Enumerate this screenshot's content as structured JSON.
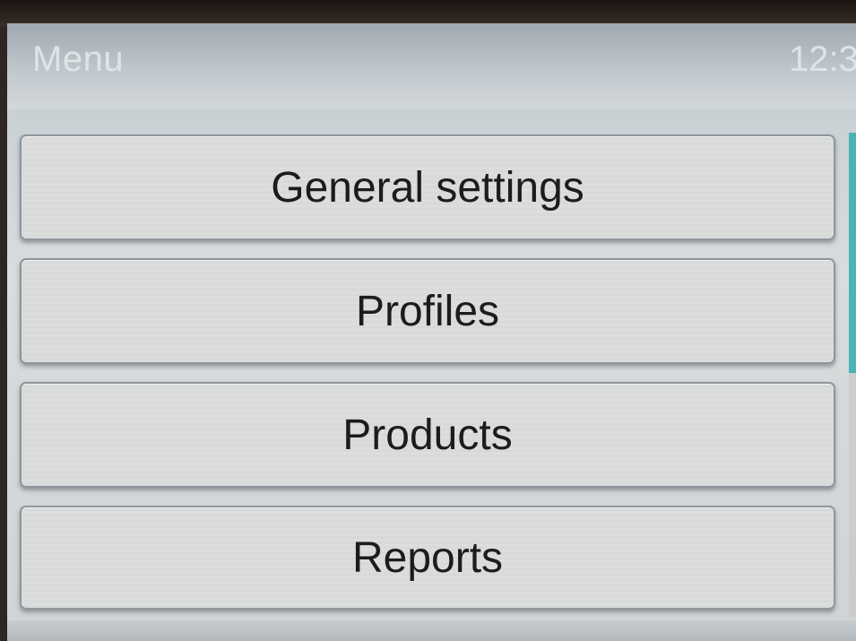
{
  "header": {
    "title": "Menu",
    "clock": "12:3"
  },
  "menu": {
    "items": [
      {
        "label": "General settings"
      },
      {
        "label": "Profiles"
      },
      {
        "label": "Products"
      },
      {
        "label": "Reports"
      }
    ]
  },
  "colors": {
    "accent": "#4ab3b6",
    "text": "#1c1c1c"
  }
}
